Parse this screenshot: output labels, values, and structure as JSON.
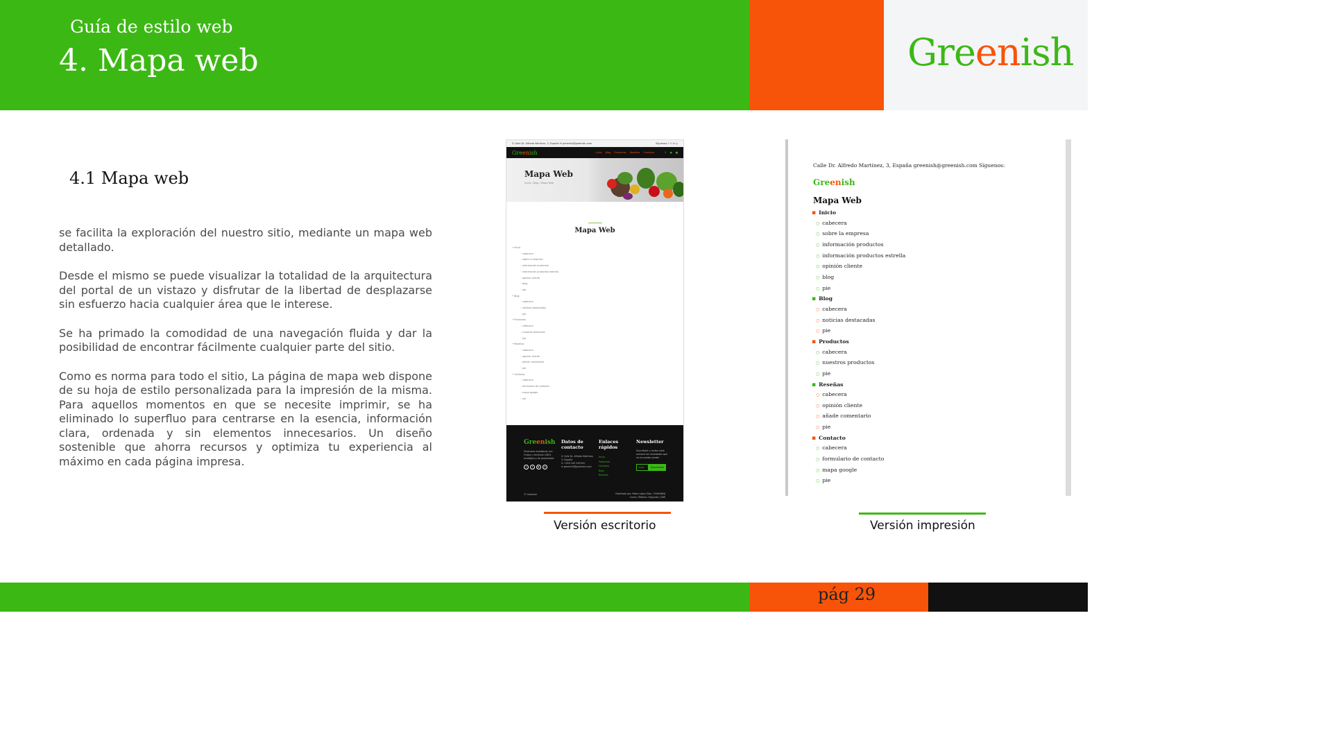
{
  "header": {
    "subtitle": "Guía de estilo web",
    "title": "4. Mapa web",
    "brand_part1": "Gre",
    "brand_part2": "en",
    "brand_part3": "i",
    "brand_part4": "sh"
  },
  "section": {
    "title": "4.1 Mapa web",
    "paragraphs": [
      "se facilita la exploración del nuestro sitio, mediante un mapa web detallado.",
      "Desde el mismo se puede visualizar la totalidad de la arquitectura del portal de un vistazo y disfrutar de la libertad de desplazarse sin esfuerzo hacia cualquier área que le interese.",
      "Se ha primado la comodidad de una navegación fluida y dar la posibilidad de encontrar fácilmente cualquier parte del sitio.",
      "Como es norma para todo el sitio, La página de mapa web dispone de su hoja de estilo personalizada para la impresión de la misma. Para aquellos momentos en que se necesite imprimir, se ha eliminado lo superfluo para centrarse en la esencia, información clara, ordenada y sin elementos innecesarios. Un diseño sostenible que ahorra recursos y optimiza tu experiencia al máximo en cada página impresa."
    ]
  },
  "desktop": {
    "topbar_left": "⚲ Calle Dr. Alfredo Martínez, 3, España    ✉ greenish@greenish.com",
    "topbar_right": "Síguenos:  f  𝕏  in  ◎",
    "logo_a": "Gre",
    "logo_b": "en",
    "logo_c": "i",
    "logo_d": "sh",
    "menu": [
      "Inicio",
      "Blog",
      "Productos",
      "Reseñas",
      "Contacto"
    ],
    "hero_title": "Mapa Web",
    "breadcrumbs": "Inicio  /  Blog  /  Mapa Web",
    "body_title": "Mapa Web",
    "sitemap": [
      {
        "section": "Inicio",
        "items": [
          "cabecera",
          "sobre la empresa",
          "información productos",
          "información productos estrella",
          "opinión cliente",
          "blog",
          "pie"
        ]
      },
      {
        "section": "Blog",
        "items": [
          "cabecera",
          "noticias destacadas",
          "pie"
        ]
      },
      {
        "section": "Productos",
        "items": [
          "cabecera",
          "nuestros productos",
          "pie"
        ]
      },
      {
        "section": "Reseñas",
        "items": [
          "cabecera",
          "opinión cliente",
          "añade comentario",
          "pie"
        ]
      },
      {
        "section": "Contacto",
        "items": [
          "cabecera",
          "formulario de contacto",
          "mapa google",
          "pie"
        ]
      }
    ],
    "footer": {
      "about": "Productos ecológicos con Frutas y verduras 100% ecológica y de proximidad",
      "contact_title": "Datos de contacto",
      "contact_lines": "⚲  Calle Dr. Alfredo Martínez, 3, España\n✆  +034 345 345345\n✉  greenish@greenish.com",
      "links_title": "Enlaces rápidos",
      "links": [
        "Inicio",
        "Productos",
        "Contacto",
        "Blog",
        "Reseñas"
      ],
      "newsletter_title": "Newsletter",
      "newsletter_text": "Suscríbete y recibe cada semana las novedades que no te puedes perder",
      "newsletter_placeholder": "email",
      "newsletter_button": "Suscribirse",
      "copyright": "© Greenish",
      "credit": "Diseñado por: Pablo López Díaz, 75465964J\nCurso / Módulo: Segundo / DIW"
    }
  },
  "print": {
    "top": "Calle Dr. Alfredo Martínez, 3, España        greenish@greenish.com Síguenos:",
    "logo_a": "Gre",
    "logo_b": "en",
    "logo_c": "i",
    "logo_d": "sh",
    "title": "Mapa Web",
    "sitemap": [
      {
        "section": "Inicio",
        "items": [
          "cabecera",
          "sobre la empresa",
          "información productos",
          "información productos estrella",
          "opinión cliente",
          "blog",
          "pie"
        ]
      },
      {
        "section": "Blog",
        "items": [
          "cabecera",
          "noticias destacadas",
          "pie"
        ]
      },
      {
        "section": "Productos",
        "items": [
          "cabecera",
          "nuestros productos",
          "pie"
        ]
      },
      {
        "section": "Reseñas",
        "items": [
          "cabecera",
          "opinión cliente",
          "añade comentario",
          "pie"
        ]
      },
      {
        "section": "Contacto",
        "items": [
          "cabecera",
          "formulario de contacto",
          "mapa google",
          "pie"
        ]
      }
    ]
  },
  "captions": {
    "desktop": "Versión escritorio",
    "print": "Versión impresión"
  },
  "footer": {
    "page": "pág 29"
  },
  "colors": {
    "green": "#3cb815",
    "orange": "#f75409",
    "dark": "#111111",
    "light": "#f4f5f7"
  }
}
